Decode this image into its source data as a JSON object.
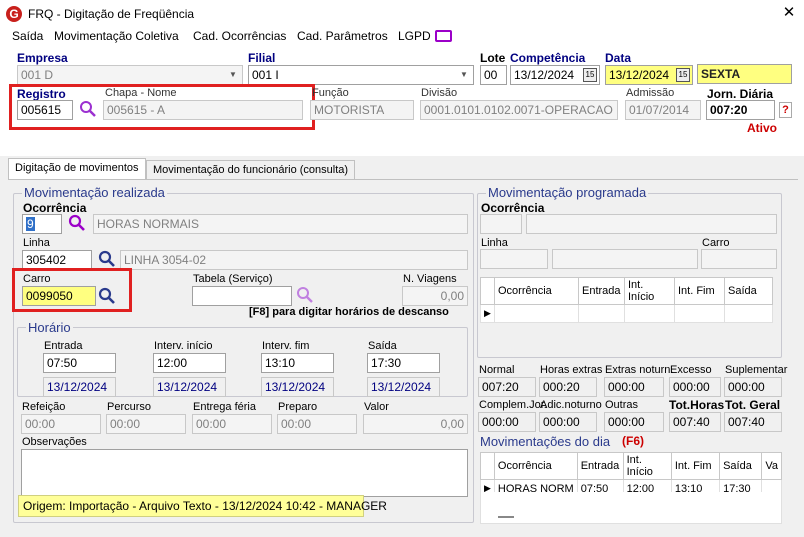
{
  "window": {
    "title": "FRQ - Digitação de Freqüência",
    "logo_letter": "G"
  },
  "menu": [
    "Saída",
    "Movimentação Coletiva",
    "Cad. Ocorrências",
    "Cad. Parâmetros",
    "LGPD"
  ],
  "header": {
    "empresa_label": "Empresa",
    "empresa_value": "001 D",
    "filial_label": "Filial",
    "filial_value": "001 I",
    "lote_label": "Lote",
    "lote_value": "00",
    "competencia_label": "Competência",
    "competencia_value": "13/12/2024",
    "competencia_btn": "15",
    "data_label": "Data",
    "data_value": "13/12/2024",
    "data_btn": "15",
    "weekday": "SEXTA",
    "registro_label": "Registro",
    "registro_value": "005615",
    "chapa_nome_label": "Chapa  -  Nome",
    "chapa_nome_value": "005615 - A",
    "funcao_label": "Função",
    "funcao_value": "MOTORISTA",
    "divisao_label": "Divisão",
    "divisao_value": "0001.0101.0102.0071-OPERACAO",
    "admissao_label": "Admissão",
    "admissao_value": "01/07/2014",
    "jornada_label": "Jorn. Diária",
    "jornada_value": "007:20",
    "help": "?",
    "status": "Ativo"
  },
  "tabs": [
    "Digitação de movimentos",
    "Movimentação do funcionário (consulta)"
  ],
  "realizada": {
    "title": "Movimentação realizada",
    "ocorrencia_label": "Ocorrência",
    "ocorrencia_code": "9",
    "ocorrencia_desc": "HORAS NORMAIS",
    "linha_label": "Linha",
    "linha_code": "305402",
    "linha_desc": "LINHA 3054-02",
    "carro_label": "Carro",
    "carro_value": "0099050",
    "tabela_label": "Tabela (Serviço)",
    "tabela_value": "",
    "nviagens_label": "N. Viagens",
    "nviagens_value": "0,00",
    "f8_hint": "[F8] para digitar horários de descanso"
  },
  "horario": {
    "title": "Horário",
    "cols": [
      {
        "label": "Entrada",
        "time": "07:50",
        "date": "13/12/2024"
      },
      {
        "label": "Interv. início",
        "time": "12:00",
        "date": "13/12/2024"
      },
      {
        "label": "Interv. fim",
        "time": "13:10",
        "date": "13/12/2024"
      },
      {
        "label": "Saída",
        "time": "17:30",
        "date": "13/12/2024"
      }
    ]
  },
  "extras": [
    {
      "label": "Refeição",
      "value": "00:00"
    },
    {
      "label": "Percurso",
      "value": "00:00"
    },
    {
      "label": "Entrega féria",
      "value": "00:00"
    },
    {
      "label": "Preparo",
      "value": "00:00"
    },
    {
      "label": "Valor",
      "value": "0,00"
    }
  ],
  "observacoes_label": "Observações",
  "origin": "Origem: Importação - Arquivo Texto - 13/12/2024 10:42 - MANAGER",
  "programada": {
    "title": "Movimentação programada",
    "ocorrencia_label": "Ocorrência",
    "linha_label": "Linha",
    "carro_label": "Carro",
    "grid_headers": [
      "Ocorrência",
      "Entrada",
      "Int. Início",
      "Int. Fim",
      "Saída"
    ]
  },
  "totals_row1": [
    {
      "label": "Normal",
      "value": "007:20"
    },
    {
      "label": "Horas extras",
      "value": "000:20"
    },
    {
      "label": "Extras noturn.",
      "value": "000:00"
    },
    {
      "label": "Excesso",
      "value": "000:00"
    },
    {
      "label": "Suplementar",
      "value": "000:00"
    }
  ],
  "totals_row2": [
    {
      "label": "Complem.Jor.",
      "value": "000:00"
    },
    {
      "label": "Adic.noturno",
      "value": "000:00"
    },
    {
      "label": "Outras",
      "value": "000:00"
    },
    {
      "label": "Tot.Horas",
      "value": "007:40"
    },
    {
      "label": "Tot. Geral",
      "value": "007:40"
    }
  ],
  "dia": {
    "title": "Movimentações do dia",
    "hotkey": "(F6)",
    "headers": [
      "Ocorrência",
      "Entrada",
      "Int. Início",
      "Int. Fim",
      "Saída",
      "Va"
    ],
    "rows": [
      [
        "HORAS NORM",
        "07:50",
        "12:00",
        "13:10",
        "17:30",
        ""
      ]
    ]
  },
  "colors": {
    "accent": "#000080",
    "highlight": "#ffff80",
    "error_box": "#e02020",
    "group_title": "#2a3a8c"
  }
}
